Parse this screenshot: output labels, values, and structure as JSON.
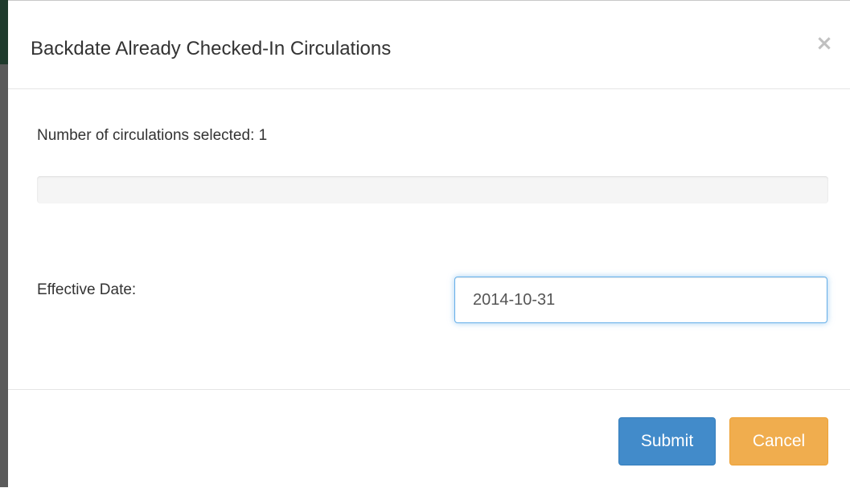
{
  "dialog": {
    "title": "Backdate Already Checked-In Circulations",
    "close_label": "×",
    "close_icon": "close-icon"
  },
  "body": {
    "count_text": "Number of circulations selected: 1",
    "progress_fraction": 0.0,
    "effective_date_label": "Effective Date:",
    "effective_date_value": "2014-10-31"
  },
  "footer": {
    "submit_label": "Submit",
    "cancel_label": "Cancel"
  },
  "colors": {
    "submit": "#428bca",
    "cancel": "#f0ad4e",
    "input_focus": "#66afe9"
  }
}
